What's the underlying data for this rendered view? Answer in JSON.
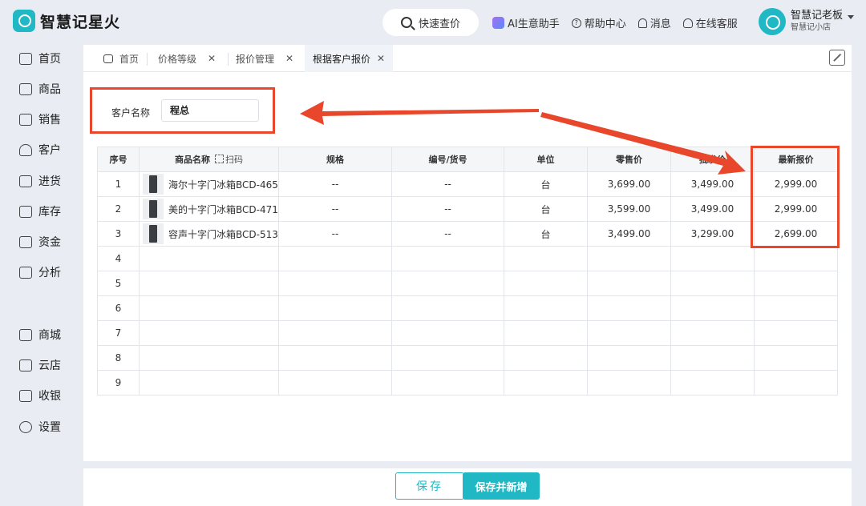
{
  "app": {
    "logo_text": "智慧记星火",
    "search_label": "快速查价",
    "topnav": [
      "AI生意助手",
      "帮助中心",
      "消息",
      "在线客服"
    ],
    "user_name": "智慧记老板",
    "user_shop": "智慧记小店"
  },
  "sidebar": {
    "items": [
      "首页",
      "商品",
      "销售",
      "客户",
      "进货",
      "库存",
      "资金",
      "分析",
      "商城",
      "云店",
      "收银",
      "设置"
    ]
  },
  "tabs": [
    {
      "label": "首页",
      "closable": false
    },
    {
      "label": "价格等级",
      "closable": true
    },
    {
      "label": "报价管理",
      "closable": true
    },
    {
      "label": "根据客户报价",
      "closable": true,
      "active": true
    }
  ],
  "form": {
    "customer_label": "客户名称",
    "customer_value": "程总"
  },
  "table": {
    "headers": [
      "序号",
      "商品名称",
      "规格",
      "编号/货号",
      "单位",
      "零售价",
      "批发价",
      "最新报价"
    ],
    "scan_label": "扫码",
    "rows": [
      {
        "no": "1",
        "name": "海尔十字门冰箱BCD-465",
        "spec": "--",
        "code": "--",
        "unit": "台",
        "retail": "3,699.00",
        "wholesale": "3,499.00",
        "latest": "2,999.00"
      },
      {
        "no": "2",
        "name": "美的十字门冰箱BCD-471",
        "spec": "--",
        "code": "--",
        "unit": "台",
        "retail": "3,599.00",
        "wholesale": "3,499.00",
        "latest": "2,999.00"
      },
      {
        "no": "3",
        "name": "容声十字门冰箱BCD-513",
        "spec": "--",
        "code": "--",
        "unit": "台",
        "retail": "3,499.00",
        "wholesale": "3,299.00",
        "latest": "2,699.00"
      },
      {
        "no": "4"
      },
      {
        "no": "5"
      },
      {
        "no": "6"
      },
      {
        "no": "7"
      },
      {
        "no": "8"
      },
      {
        "no": "9"
      }
    ]
  },
  "buttons": {
    "save": "保存",
    "save_new": "保存并新增"
  },
  "colors": {
    "accent": "#1fb8c4",
    "annotation": "#e8472b"
  }
}
